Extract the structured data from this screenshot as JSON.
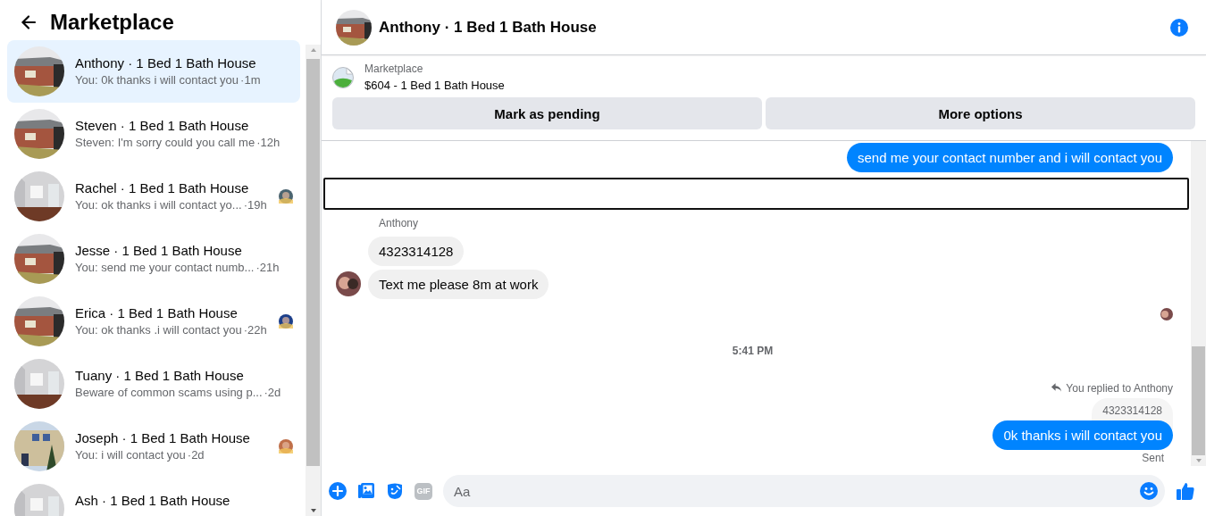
{
  "sidebar": {
    "title": "Marketplace",
    "conversations": [
      {
        "title": "Anthony · 1 Bed 1 Bath House",
        "preview": "You: 0k thanks i will contact you",
        "time": "·1m",
        "selected": true,
        "seen_avatar": false
      },
      {
        "title": "Steven · 1 Bed 1 Bath House",
        "preview": "Steven: I'm sorry could you call me",
        "time": "·12h",
        "selected": false,
        "seen_avatar": false
      },
      {
        "title": "Rachel · 1 Bed 1 Bath House",
        "preview": "You: ok thanks i will contact yo...",
        "time": "·19h",
        "selected": false,
        "seen_avatar": true
      },
      {
        "title": "Jesse · 1 Bed 1 Bath House",
        "preview": "You: send me your contact numb...",
        "time": "·21h",
        "selected": false,
        "seen_avatar": false
      },
      {
        "title": "Erica · 1 Bed 1 Bath House",
        "preview": "You: ok thanks .i will contact you",
        "time": "·22h",
        "selected": false,
        "seen_avatar": true
      },
      {
        "title": "Tuany · 1 Bed 1 Bath House",
        "preview": "Beware of common scams using p...",
        "time": "·2d",
        "selected": false,
        "seen_avatar": false
      },
      {
        "title": "Joseph · 1 Bed 1 Bath House",
        "preview": "You: i will contact you",
        "time": "·2d",
        "selected": false,
        "seen_avatar": true
      },
      {
        "title": "Ash · 1 Bed 1 Bath House",
        "selected": false,
        "seen_avatar": false
      }
    ]
  },
  "chat": {
    "title": "Anthony · 1 Bed 1 Bath House",
    "listing": {
      "source": "Marketplace",
      "name": "$604 - 1 Bed 1 Bath House"
    },
    "buttons": [
      "Mark as pending",
      "More options"
    ],
    "messages": [
      {
        "kind": "outgoing",
        "text": "send me your contact number and i will contact you"
      },
      {
        "kind": "outline"
      },
      {
        "kind": "sender",
        "text": "Anthony"
      },
      {
        "kind": "incoming",
        "text": "4323314128",
        "avatar": false
      },
      {
        "kind": "incoming",
        "text": "Text me please 8m at work",
        "avatar": true
      },
      {
        "kind": "seen"
      },
      {
        "kind": "timestamp",
        "text": "5:41 PM"
      },
      {
        "kind": "reply_note",
        "text": "You replied to Anthony"
      },
      {
        "kind": "quoted",
        "text": "4323314128"
      },
      {
        "kind": "outgoing",
        "text": "0k thanks i will contact you"
      },
      {
        "kind": "status",
        "text": "Sent"
      }
    ],
    "composer": {
      "gif_label": "GIF",
      "placeholder": "Aa"
    }
  }
}
